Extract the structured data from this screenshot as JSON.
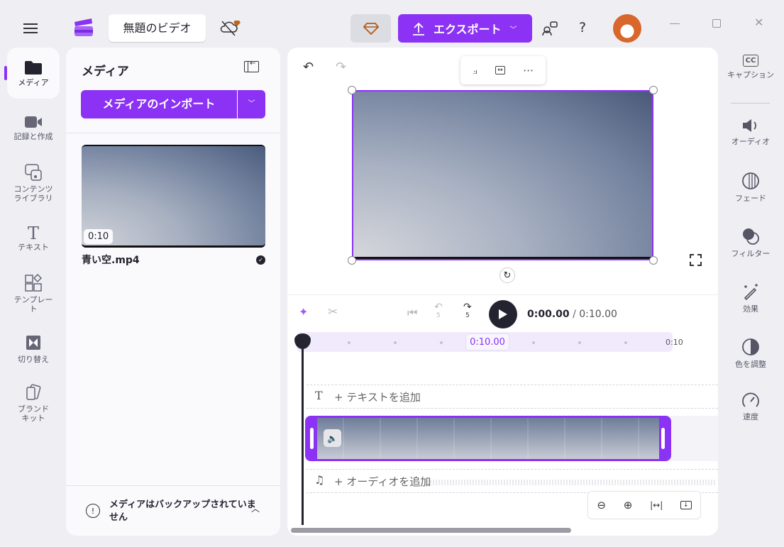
{
  "header": {
    "title": "無題のビデオ",
    "export_label": "エクスポート",
    "help": "?"
  },
  "left_nav": [
    {
      "label": "メディア",
      "icon": "folder-icon"
    },
    {
      "label": "記録と作成",
      "icon": "video-camera-icon"
    },
    {
      "label": "コンテンツ ライブラリ",
      "icon": "content-library-icon"
    },
    {
      "label": "テキスト",
      "icon": "text-icon"
    },
    {
      "label": "テンプレート",
      "icon": "template-icon"
    },
    {
      "label": "切り替え",
      "icon": "transition-icon"
    },
    {
      "label": "ブランド キット",
      "icon": "brand-kit-icon"
    }
  ],
  "media_panel": {
    "title": "メディア",
    "import_label": "メディアのインポート",
    "item": {
      "duration": "0:10",
      "filename": "青い空.mp4"
    },
    "backup_notice": "メディアはバックアップされていません"
  },
  "player": {
    "current_time": "0:00.00",
    "separator": "/",
    "total_time": "0:10.00",
    "skip_back": "5",
    "skip_forward": "5"
  },
  "timeline": {
    "marker": "0:10.00",
    "end_label": "0:10",
    "add_text": "+ テキストを追加",
    "add_audio": "+ オーディオを追加"
  },
  "right_nav": [
    {
      "label": "キャプション",
      "icon": "captions-icon"
    },
    {
      "label": "オーディオ",
      "icon": "speaker-icon"
    },
    {
      "label": "フェード",
      "icon": "fade-icon"
    },
    {
      "label": "フィルター",
      "icon": "filter-icon"
    },
    {
      "label": "効果",
      "icon": "magic-wand-icon"
    },
    {
      "label": "色を調整",
      "icon": "color-adjust-icon"
    },
    {
      "label": "速度",
      "icon": "speedometer-icon"
    }
  ],
  "colors": {
    "accent": "#8b32f5",
    "bg": "#eeeef3"
  }
}
